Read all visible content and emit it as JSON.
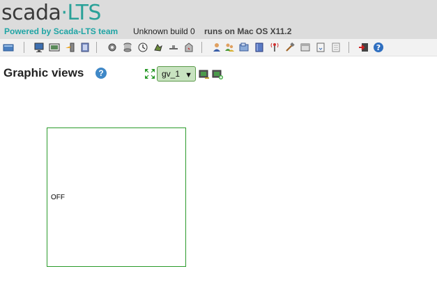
{
  "header": {
    "logo_part1": "scada",
    "logo_dot": "·",
    "logo_part2": "LTS",
    "powered_by": "Powered by Scada-LTS team",
    "build": "Unknown build 0",
    "runs_on": "runs on Mac OS X11.2"
  },
  "toolbar": {
    "icons": [
      "watchlist-icon",
      "graphic-views-icon",
      "events-icon",
      "reports-icon",
      "point-links-icon",
      "data-sources-icon",
      "scheduled-events-icon",
      "compound-events-icon",
      "event-handlers-icon",
      "point-hierarchy-icon",
      "users-icon",
      "user-profiles-icon",
      "mailing-lists-icon",
      "publishers-icon",
      "maintenance-events-icon",
      "scripting-icon",
      "sql-icon",
      "import-export-icon",
      "system-settings-icon",
      "logout-icon",
      "help-icon"
    ]
  },
  "page": {
    "title": "Graphic views",
    "help_glyph": "?"
  },
  "view_selector": {
    "selected": "gv_1"
  },
  "view": {
    "components": [
      {
        "label": "OFF"
      }
    ]
  },
  "colors": {
    "header_bg": "#dcdcdc",
    "powered_by": "#20a5a5",
    "view_border": "#2a9a2a",
    "select_bg": "#c8e3c0"
  }
}
